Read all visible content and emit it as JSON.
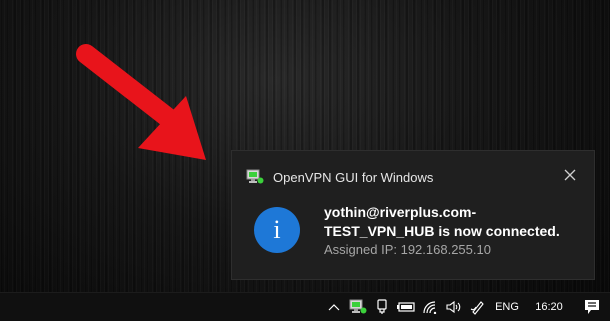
{
  "notification": {
    "app_name": "OpenVPN GUI for Windows",
    "app_icon": "openvpn-monitor-icon",
    "close_icon": "close-icon",
    "info_icon_glyph": "i",
    "title": "yothin@riverplus.com-\nTEST_VPN_HUB is now connected.",
    "body": "Assigned IP: 192.168.255.10"
  },
  "annotation": {
    "arrow_color": "#e8141b"
  },
  "taskbar": {
    "tray_icons": [
      "chevron-up-icon",
      "openvpn-connected-icon",
      "usb-device-icon",
      "battery-icon",
      "wifi-icon",
      "speaker-icon",
      "pen-icon"
    ],
    "language": "ENG",
    "time": "16:20",
    "action_center_icon": "notification-center-icon"
  },
  "colors": {
    "toast_bg": "#1f1f1f",
    "info_blue": "#1e78d7",
    "vpn_green": "#3bd13b"
  }
}
